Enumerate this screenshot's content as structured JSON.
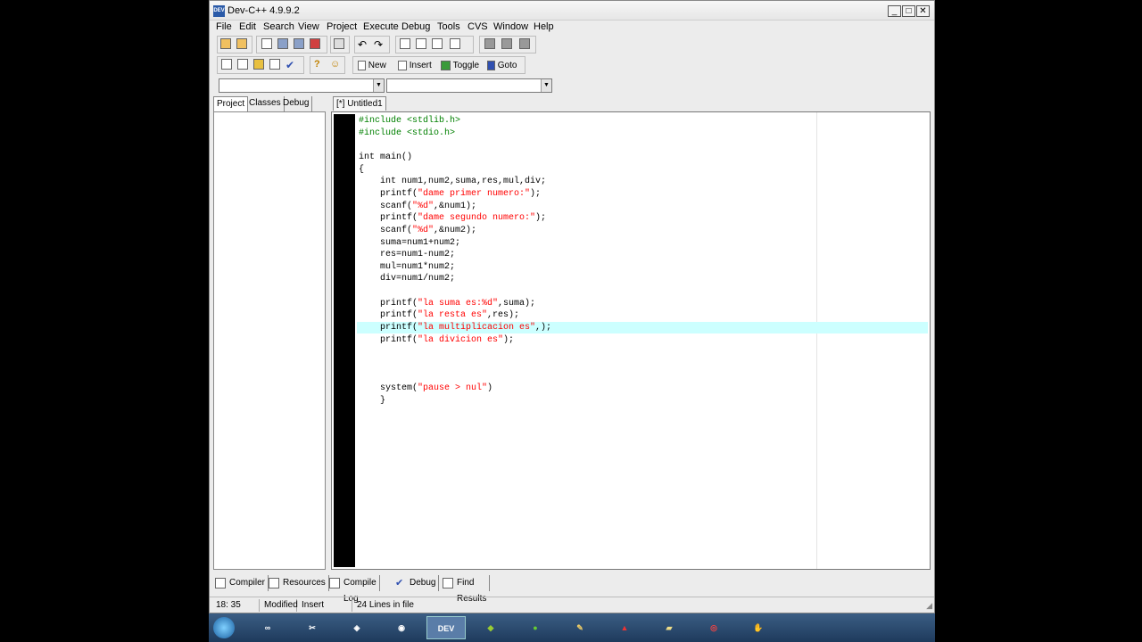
{
  "window": {
    "title": "Dev-C++ 4.9.9.2",
    "app_icon_text": "DEV"
  },
  "menu": [
    "File",
    "Edit",
    "Search",
    "View",
    "Project",
    "Execute",
    "Debug",
    "Tools",
    "CVS",
    "Window",
    "Help"
  ],
  "toolbar2": {
    "new_label": "New",
    "insert_label": "Insert",
    "toggle_label": "Toggle",
    "goto_label": "Goto"
  },
  "left_tabs": [
    "Project",
    "Classes",
    "Debug"
  ],
  "editor_tab": "[*] Untitled1",
  "code": [
    "#include <stdlib.h>",
    "#include <stdio.h>",
    "",
    "int main()",
    "{",
    "    int num1,num2,suma,res,mul,div;",
    "    printf(\"dame primer numero:\");",
    "    scanf(\"%d\",&num1);",
    "    printf(\"dame segundo numero:\");",
    "    scanf(\"%d\",&num2);",
    "    suma=num1+num2;",
    "    res=num1-num2;",
    "    mul=num1*num2;",
    "    div=num1/num2;",
    "",
    "    printf(\"la suma es:%d\",suma);",
    "    printf(\"la resta es\",res);",
    "    printf(\"la multiplicacion es\",);",
    "    printf(\"la divicion es\");",
    "",
    "",
    "",
    "    system(\"pause > nul\")",
    "    }"
  ],
  "bottom_tabs": [
    "Compiler",
    "Resources",
    "Compile Log",
    "Debug",
    "Find Results"
  ],
  "status": {
    "position": "18: 35",
    "modified": "Modified",
    "mode": "Insert",
    "lines": "24 Lines in file"
  },
  "colors": {
    "preprocessor": "#008000",
    "string": "#ff0000",
    "highlight": "#ccffff",
    "gutter": "#000000"
  },
  "taskbar_icons": [
    "start-orb",
    "app-infinity",
    "app-tools",
    "app-cube",
    "app-eclipse",
    "app-devcpp",
    "app-android",
    "app-green-circle",
    "app-leaf",
    "app-pdf",
    "app-folder",
    "app-chrome",
    "app-orange"
  ]
}
